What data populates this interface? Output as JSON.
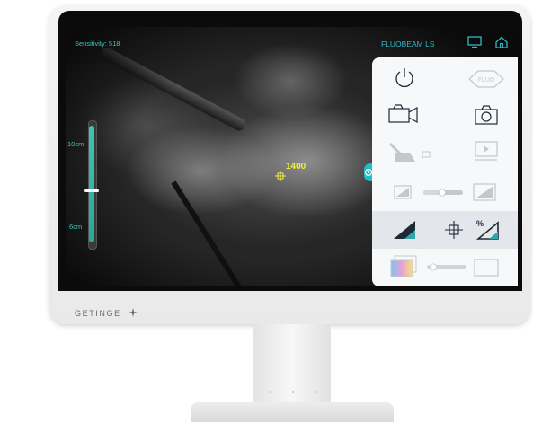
{
  "overlay": {
    "sensitivity_text": "Sensitivity: 518",
    "mode_title": "FLUOBEAM LS",
    "scale_top": "10cm",
    "scale_bottom": "6cm",
    "measurement_value": "1400"
  },
  "panel": {
    "fluo_label": "FLUO",
    "controls": [
      "power-icon",
      "fluo-mode-icon",
      "video-camera-icon",
      "photo-camera-icon",
      "laser-toggle-icon",
      "playback-icon",
      "brightness-down-icon",
      "brightness-slider",
      "brightness-up-icon",
      "gain-icon",
      "target-crosshair-icon",
      "percent-gain-icon",
      "color-palette-icon",
      "overlay-slider",
      "blank-frame-icon"
    ]
  },
  "brand": {
    "name": "GETINGE"
  },
  "colors": {
    "accent": "#2fb7c4",
    "scale": "#3fc4b6",
    "measure": "#f2ef3a",
    "panel_bg": "#f7f8f9",
    "icon_dark": "#1e2a38"
  }
}
